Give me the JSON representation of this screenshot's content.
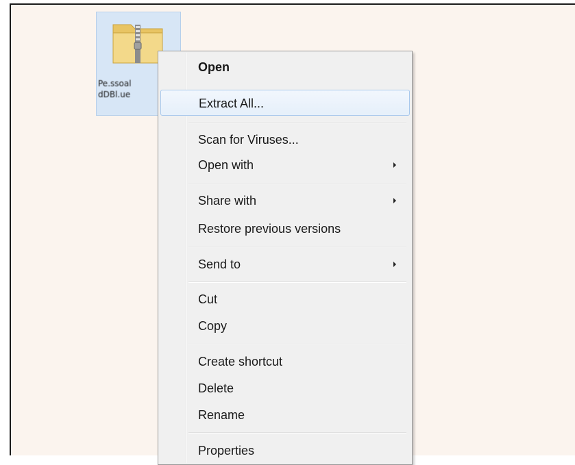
{
  "desktop": {
    "icon": {
      "name": "zip-folder-icon",
      "label_line1": "Pe.ssoal",
      "label_line2": "dDBl.ue"
    }
  },
  "context_menu": {
    "open": "Open",
    "extract_all": "Extract All...",
    "scan_for_viruses": "Scan for Viruses...",
    "open_with": "Open with",
    "share_with": "Share with",
    "restore_previous_versions": "Restore previous versions",
    "send_to": "Send to",
    "cut": "Cut",
    "copy": "Copy",
    "create_shortcut": "Create shortcut",
    "delete": "Delete",
    "rename": "Rename",
    "properties": "Properties"
  },
  "colors": {
    "desktop_background": "#fbf4ee",
    "selection_fill": "#d7e6f6",
    "menu_background": "#f0f0f0",
    "hover_border": "#a8c8ec"
  },
  "icons": {
    "submenu_arrow": "chevron-right-icon",
    "folder": "zip-folder-icon"
  }
}
